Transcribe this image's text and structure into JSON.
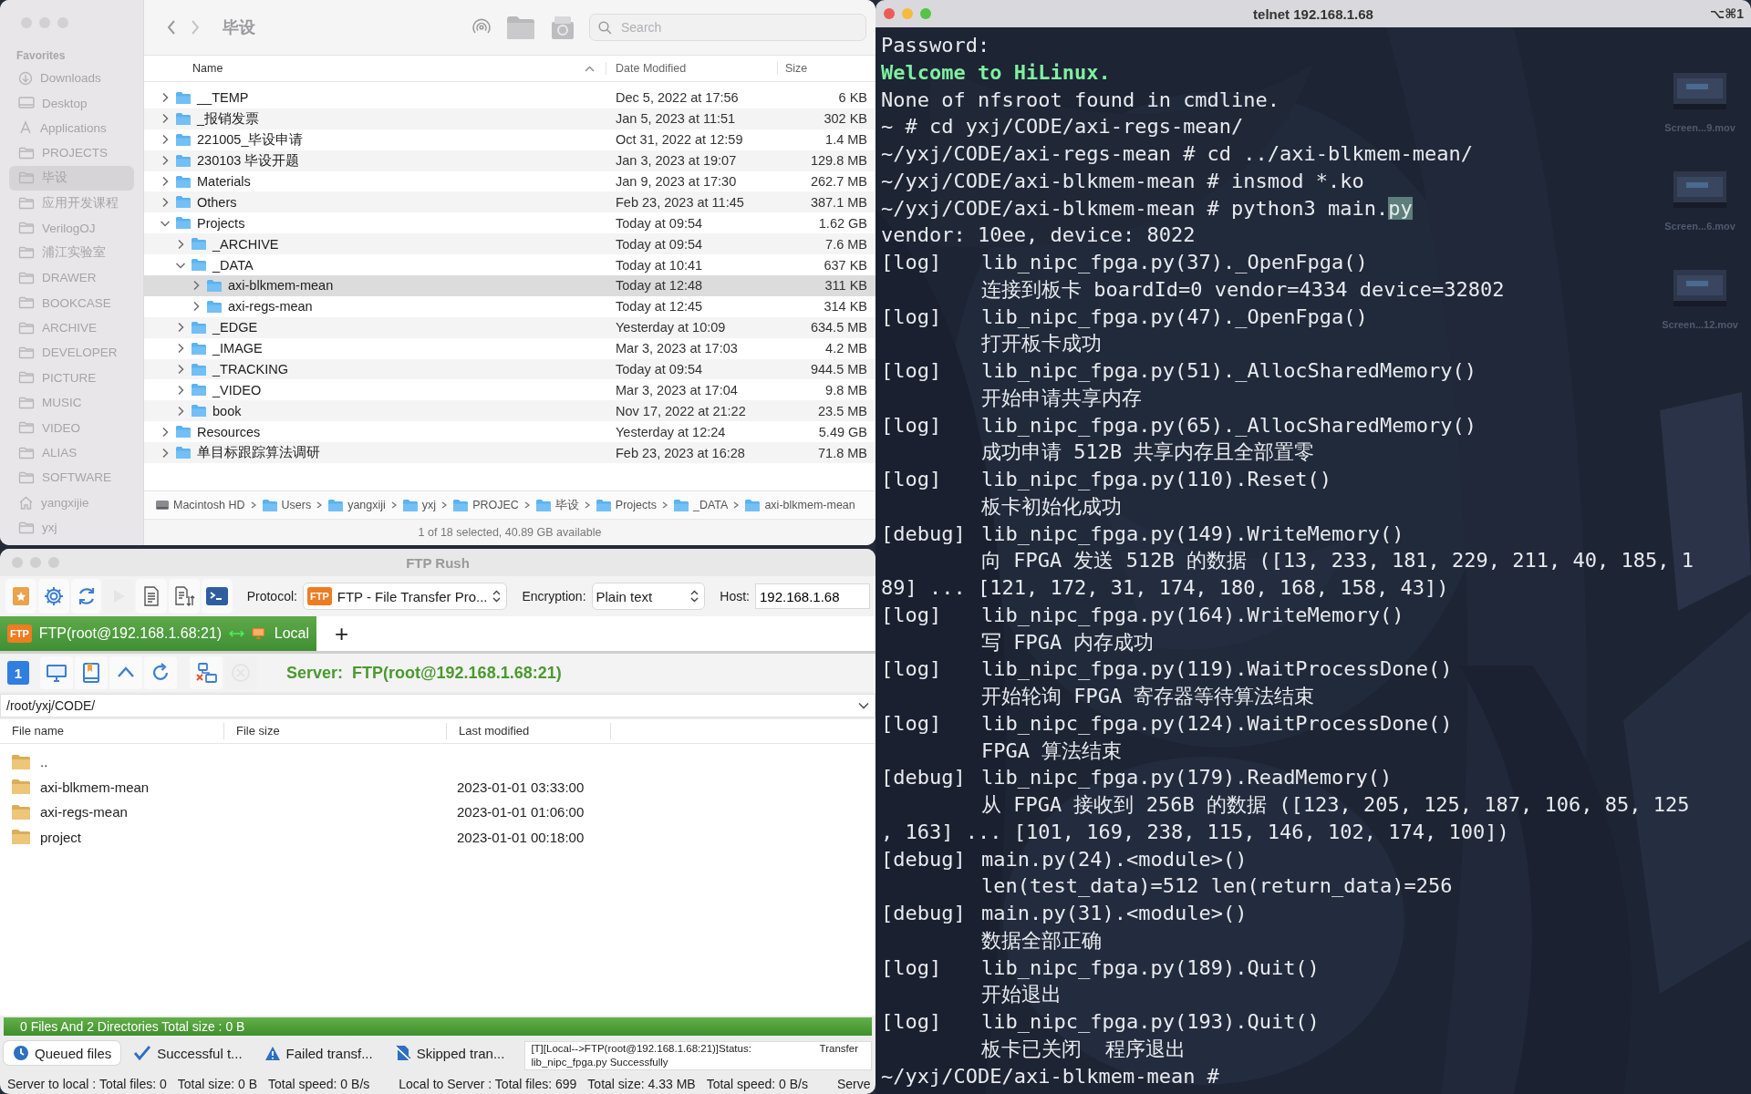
{
  "finder": {
    "title": "毕设",
    "search": {
      "placeholder": "Search"
    },
    "sidebar": {
      "heading": "Favorites",
      "items": [
        {
          "label": "Downloads",
          "kind": "download",
          "selected": false
        },
        {
          "label": "Desktop",
          "kind": "desktop",
          "selected": false
        },
        {
          "label": "Applications",
          "kind": "apps",
          "selected": false
        },
        {
          "label": "PROJECTS",
          "kind": "folder",
          "selected": false
        },
        {
          "label": "毕设",
          "kind": "folder",
          "selected": true
        },
        {
          "label": "应用开发课程",
          "kind": "folder",
          "selected": false
        },
        {
          "label": "VerilogOJ",
          "kind": "folder",
          "selected": false
        },
        {
          "label": "浦江实验室",
          "kind": "folder",
          "selected": false
        },
        {
          "label": "DRAWER",
          "kind": "folder",
          "selected": false
        },
        {
          "label": "BOOKCASE",
          "kind": "folder",
          "selected": false
        },
        {
          "label": "ARCHIVE",
          "kind": "folder",
          "selected": false
        },
        {
          "label": "DEVELOPER",
          "kind": "folder",
          "selected": false
        },
        {
          "label": "PICTURE",
          "kind": "folder",
          "selected": false
        },
        {
          "label": "MUSIC",
          "kind": "folder",
          "selected": false
        },
        {
          "label": "VIDEO",
          "kind": "folder",
          "selected": false
        },
        {
          "label": "ALIAS",
          "kind": "folder",
          "selected": false
        },
        {
          "label": "SOFTWARE",
          "kind": "folder",
          "selected": false
        },
        {
          "label": "yangxijie",
          "kind": "home",
          "selected": false
        },
        {
          "label": "yxj",
          "kind": "folder",
          "selected": false
        }
      ]
    },
    "columns": [
      {
        "label": "Name",
        "sorted": true
      },
      {
        "label": "Date Modified",
        "sorted": false
      },
      {
        "label": "Size",
        "sorted": false
      }
    ],
    "rows": [
      {
        "name": "__TEMP",
        "date": "Dec 5, 2022 at 17:56",
        "size": "6 KB",
        "expanded": false,
        "selected": false
      },
      {
        "name": "_报销发票",
        "date": "Jan 5, 2023 at 11:51",
        "size": "302 KB",
        "expanded": false,
        "selected": false
      },
      {
        "name": "221005_毕设申请",
        "date": "Oct 31, 2022 at 12:59",
        "size": "1.4 MB",
        "expanded": false,
        "selected": false
      },
      {
        "name": "230103 毕设开题",
        "date": "Jan 3, 2023 at 19:07",
        "size": "129.8 MB",
        "expanded": false,
        "selected": false
      },
      {
        "name": "Materials",
        "date": "Jan 9, 2023 at 17:30",
        "size": "262.7 MB",
        "expanded": false,
        "selected": false
      },
      {
        "name": "Others",
        "date": "Feb 23, 2023 at 11:45",
        "size": "387.1 MB",
        "expanded": false,
        "selected": false
      },
      {
        "name": "Projects",
        "date": "Today at 09:54",
        "size": "1.62 GB",
        "expanded": true,
        "selected": false,
        "children": [
          {
            "name": "_ARCHIVE",
            "date": "Today at 09:54",
            "size": "7.6 MB",
            "expanded": false,
            "selected": false
          },
          {
            "name": "_DATA",
            "date": "Today at 10:41",
            "size": "637 KB",
            "expanded": true,
            "selected": false,
            "children": [
              {
                "name": "axi-blkmem-mean",
                "date": "Today at 12:48",
                "size": "311 KB",
                "expanded": false,
                "selected": true
              },
              {
                "name": "axi-regs-mean",
                "date": "Today at 12:45",
                "size": "314 KB",
                "expanded": false,
                "selected": false
              }
            ]
          },
          {
            "name": "_EDGE",
            "date": "Yesterday at 10:09",
            "size": "634.5 MB",
            "expanded": false,
            "selected": false
          },
          {
            "name": "_IMAGE",
            "date": "Mar 3, 2023 at 17:03",
            "size": "4.2 MB",
            "expanded": false,
            "selected": false
          },
          {
            "name": "_TRACKING",
            "date": "Today at 09:54",
            "size": "944.5 MB",
            "expanded": false,
            "selected": false
          },
          {
            "name": "_VIDEO",
            "date": "Mar 3, 2023 at 17:04",
            "size": "9.8 MB",
            "expanded": false,
            "selected": false
          },
          {
            "name": "book",
            "date": "Nov 17, 2022 at 21:22",
            "size": "23.5 MB",
            "expanded": false,
            "selected": false
          }
        ]
      },
      {
        "name": "Resources",
        "date": "Yesterday at 12:24",
        "size": "5.49 GB",
        "expanded": false,
        "selected": false
      },
      {
        "name": "单目标跟踪算法调研",
        "date": "Feb 23, 2023 at 16:28",
        "size": "71.8 MB",
        "expanded": false,
        "selected": false
      }
    ],
    "path": [
      {
        "label": "Macintosh HD",
        "kind": "disk"
      },
      {
        "label": "Users",
        "kind": "users"
      },
      {
        "label": "yangxiji",
        "kind": "home"
      },
      {
        "label": "yxj",
        "kind": "folder"
      },
      {
        "label": "PROJEC",
        "kind": "folder"
      },
      {
        "label": "毕设",
        "kind": "folder"
      },
      {
        "label": "Projects",
        "kind": "folder"
      },
      {
        "label": "_DATA",
        "kind": "folder"
      },
      {
        "label": "axi-blkmem-mean",
        "kind": "folder"
      }
    ],
    "status": "1 of 18 selected, 40.89 GB available"
  },
  "ftp": {
    "title": "FTP Rush",
    "toolbar": [
      {
        "kind": "bookmark",
        "disabled": false
      },
      {
        "kind": "settings",
        "disabled": false
      },
      {
        "kind": "sync",
        "disabled": false
      },
      {
        "kind": "play",
        "disabled": true
      },
      {
        "kind": "document",
        "disabled": false
      },
      {
        "kind": "transfer",
        "disabled": false
      },
      {
        "kind": "terminal",
        "disabled": false
      }
    ],
    "protocol": {
      "label": "Protocol:",
      "badge": "FTP",
      "value": "FTP - File Transfer Pro..."
    },
    "encryption": {
      "label": "Encryption:",
      "value": "Plain text"
    },
    "host": {
      "label": "Host:",
      "value": "192.168.1.68"
    },
    "tabs": [
      {
        "badge": "FTP",
        "label": "FTP(root@192.168.1.68:21)",
        "local": "Local",
        "selected": true
      }
    ],
    "new_tab": "+",
    "nav": [
      {
        "kind": "number",
        "label": "1",
        "disabled": false
      },
      {
        "kind": "monitor",
        "disabled": false
      },
      {
        "kind": "bookmarks",
        "disabled": false
      },
      {
        "kind": "up",
        "disabled": false
      },
      {
        "kind": "refresh",
        "disabled": false
      },
      {
        "kind": "disconnect",
        "disabled": false
      },
      {
        "kind": "cancel",
        "disabled": true
      }
    ],
    "server_label": "Server:",
    "server": "FTP(root@192.168.1.68:21)",
    "path": "/root/yxj/CODE/",
    "columns": [
      "File name",
      "File size",
      "Last modified"
    ],
    "files": [
      {
        "name": ".."
      },
      {
        "name": "axi-blkmem-mean",
        "modified": "2023-01-01 03:33:00"
      },
      {
        "name": "axi-regs-mean",
        "modified": "2023-01-01 01:06:00"
      },
      {
        "name": "project",
        "modified": "2023-01-01 00:18:00"
      }
    ],
    "summary": "0 Files And 2 Directories Total size : 0 B",
    "queue_tabs": [
      {
        "label": "Queued files",
        "kind": "queued",
        "selected": true
      },
      {
        "label": "Successful t...",
        "kind": "success",
        "selected": false
      },
      {
        "label": "Failed transf...",
        "kind": "failed",
        "selected": false
      },
      {
        "label": "Skipped tran...",
        "kind": "skipped",
        "selected": false
      }
    ],
    "log": {
      "status": "[T][Local-->FTP(root@192.168.1.68:21)]Status:",
      "action": "Transfer",
      "detail": "lib_nipc_fpga.py Successfully"
    },
    "status_bar": [
      "Server to local : Total files: 0",
      "Total size: 0 B",
      "Total speed: 0 B/s",
      "Local to Server : Total files: 699",
      "Total size: 4.33 MB",
      "Total speed: 0 B/s",
      "Serve"
    ]
  },
  "terminal": {
    "title": "telnet 192.168.1.68",
    "shortcut": "⌥⌘1",
    "desktop_files": [
      {
        "label": "Screen...9.mov"
      },
      {
        "label": "Screen...6.mov"
      },
      {
        "label": "Screen...12.mov"
      }
    ],
    "lines": [
      {
        "kind": "plain",
        "text": "Password:"
      },
      {
        "kind": "banner",
        "text": "Welcome to HiLinux."
      },
      {
        "kind": "plain",
        "text": "None of nfsroot found in cmdline."
      },
      {
        "kind": "plain",
        "text": "~ # cd yxj/CODE/axi-regs-mean/"
      },
      {
        "kind": "plain",
        "text": "~/yxj/CODE/axi-regs-mean # cd ../axi-blkmem-mean/"
      },
      {
        "kind": "plain",
        "text": "~/yxj/CODE/axi-blkmem-mean # insmod *.ko"
      },
      {
        "kind": "plain",
        "text": "~/yxj/CODE/axi-blkmem-mean # python3 main.",
        "selected_text": "py"
      },
      {
        "kind": "plain",
        "text": "vendor: 10ee, device: 8022"
      },
      {
        "kind": "log",
        "tag": "[log]",
        "text": "lib_nipc_fpga.py(37)._OpenFpga()"
      },
      {
        "kind": "detail",
        "text": "连接到板卡 boardId=0 vendor=4334 device=32802"
      },
      {
        "kind": "log",
        "tag": "[log]",
        "text": "lib_nipc_fpga.py(47)._OpenFpga()"
      },
      {
        "kind": "detail",
        "text": "打开板卡成功"
      },
      {
        "kind": "log",
        "tag": "[log]",
        "text": "lib_nipc_fpga.py(51)._AllocSharedMemory()"
      },
      {
        "kind": "detail",
        "text": "开始申请共享内存"
      },
      {
        "kind": "log",
        "tag": "[log]",
        "text": "lib_nipc_fpga.py(65)._AllocSharedMemory()"
      },
      {
        "kind": "detail",
        "text": "成功申请 512B 共享内存且全部置零"
      },
      {
        "kind": "log",
        "tag": "[log]",
        "text": "lib_nipc_fpga.py(110).Reset()"
      },
      {
        "kind": "detail",
        "text": "板卡初始化成功"
      },
      {
        "kind": "log",
        "tag": "[debug]",
        "text": "lib_nipc_fpga.py(149).WriteMemory()"
      },
      {
        "kind": "detail",
        "text": "向 FPGA 发送 512B 的数据 ([13, 233, 181, 229, 211, 40, 185, 1"
      },
      {
        "kind": "plain",
        "text": "89] ... [121, 172, 31, 174, 180, 168, 158, 43])"
      },
      {
        "kind": "log",
        "tag": "[log]",
        "text": "lib_nipc_fpga.py(164).WriteMemory()"
      },
      {
        "kind": "detail",
        "text": "写 FPGA 内存成功"
      },
      {
        "kind": "log",
        "tag": "[log]",
        "text": "lib_nipc_fpga.py(119).WaitProcessDone()"
      },
      {
        "kind": "detail",
        "text": "开始轮询 FPGA 寄存器等待算法结束"
      },
      {
        "kind": "log",
        "tag": "[log]",
        "text": "lib_nipc_fpga.py(124).WaitProcessDone()"
      },
      {
        "kind": "detail",
        "text": "FPGA 算法结束"
      },
      {
        "kind": "log",
        "tag": "[debug]",
        "text": "lib_nipc_fpga.py(179).ReadMemory()"
      },
      {
        "kind": "detail",
        "text": "从 FPGA 接收到 256B 的数据 ([123, 205, 125, 187, 106, 85, 125"
      },
      {
        "kind": "plain",
        "text": ", 163] ... [101, 169, 238, 115, 146, 102, 174, 100])"
      },
      {
        "kind": "log",
        "tag": "[debug]",
        "text": "main.py(24).<module>()"
      },
      {
        "kind": "detail",
        "text": "len(test_data)=512 len(return_data)=256"
      },
      {
        "kind": "log",
        "tag": "[debug]",
        "text": "main.py(31).<module>()"
      },
      {
        "kind": "detail",
        "text": "数据全部正确"
      },
      {
        "kind": "log",
        "tag": "[log]",
        "text": "lib_nipc_fpga.py(189).Quit()"
      },
      {
        "kind": "detail",
        "text": "开始退出"
      },
      {
        "kind": "log",
        "tag": "[log]",
        "text": "lib_nipc_fpga.py(193).Quit()"
      },
      {
        "kind": "detail",
        "text": "板卡已关闭  程序退出"
      },
      {
        "kind": "plain",
        "text": "~/yxj/CODE/axi-blkmem-mean #"
      }
    ]
  }
}
